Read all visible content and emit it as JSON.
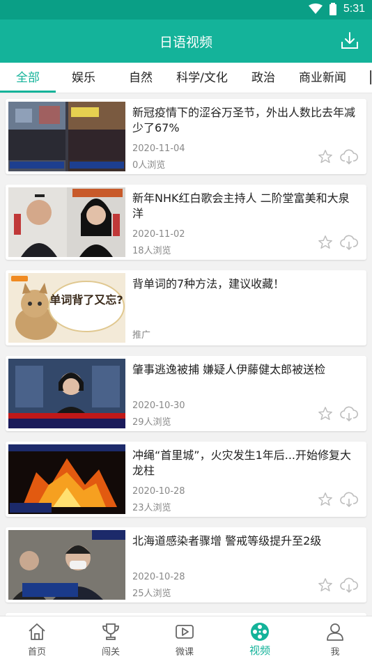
{
  "status_bar": {
    "time": "5:31"
  },
  "app_bar": {
    "title": "日语视频"
  },
  "tabs": [
    {
      "label": "全部",
      "active": true
    },
    {
      "label": "娱乐"
    },
    {
      "label": "自然"
    },
    {
      "label": "科学/文化"
    },
    {
      "label": "政治"
    },
    {
      "label": "商业新闻"
    }
  ],
  "videos": [
    {
      "title": "新冠疫情下的涩谷万圣节，外出人数比去年减少了67%",
      "date": "2020-11-04",
      "views": "0人浏览"
    },
    {
      "title": "新年NHK红白歌会主持人 二阶堂富美和大泉洋",
      "date": "2020-11-02",
      "views": "18人浏览"
    },
    {
      "title": "背单词的7种方法，建议收藏！",
      "tag": "推广",
      "thumb_text": "单词背了又忘?"
    },
    {
      "title": "肇事逃逸被捕 嫌疑人伊藤健太郎被送检",
      "date": "2020-10-30",
      "views": "29人浏览"
    },
    {
      "title": "冲绳“首里城”，火灾发生1年后...开始修复大龙柱",
      "date": "2020-10-28",
      "views": "23人浏览"
    },
    {
      "title": "北海道感染者骤增 警戒等级提升至2级",
      "date": "2020-10-28",
      "views": "25人浏览"
    }
  ],
  "bottom_nav": [
    {
      "label": "首页",
      "icon": "home-icon"
    },
    {
      "label": "闯关",
      "icon": "trophy-icon"
    },
    {
      "label": "微课",
      "icon": "play-icon"
    },
    {
      "label": "视频",
      "icon": "film-reel-icon",
      "active": true
    },
    {
      "label": "我",
      "icon": "person-icon"
    }
  ],
  "colors": {
    "accent": "#14b39a",
    "status_bar": "#0a9f86"
  }
}
